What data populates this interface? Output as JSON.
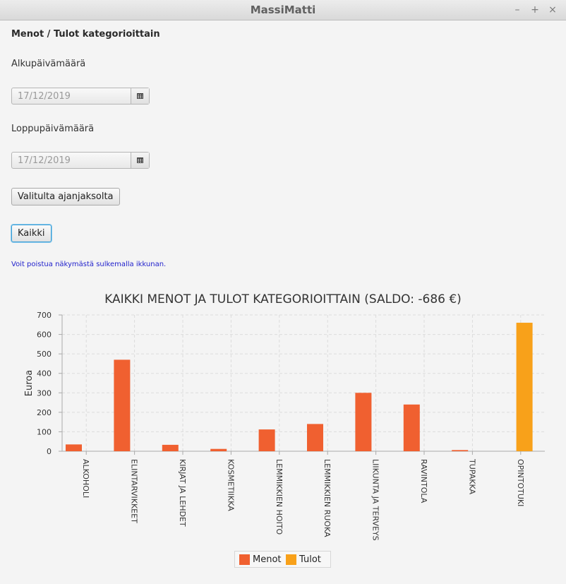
{
  "window": {
    "title": "MassiMatti",
    "minimize": "–",
    "maximize": "+",
    "close": "×"
  },
  "heading": "Menot / Tulot kategorioittain",
  "start_date": {
    "label": "Alkupäivämäärä",
    "value": "17/12/2019"
  },
  "end_date": {
    "label": "Loppupäivämäärä",
    "value": "17/12/2019"
  },
  "buttons": {
    "period": "Valitulta ajanjaksolta",
    "all": "Kaikki"
  },
  "hint": "Voit poistua näkymästä sulkemalla ikkunan.",
  "colors": {
    "menot": "#f06030",
    "tulot": "#f8a11a"
  },
  "chart_data": {
    "type": "bar",
    "title": "KAIKKI MENOT JA TULOT KATEGORIOITTAIN (SALDO: -686 €)",
    "ylabel": "Euroa",
    "xlabel": "",
    "ylim": [
      0,
      700
    ],
    "yticks": [
      0,
      100,
      200,
      300,
      400,
      500,
      600,
      700
    ],
    "grid": true,
    "legend_position": "bottom",
    "categories": [
      "ALKOHOLI",
      "ELINTARVIKKEET",
      "KIRJAT JA LEHDET",
      "KOSMETIIKKA",
      "LEMMIKKIEN HOITO",
      "LEMMIKKIEN RUOKA",
      "LIIKUNTA JA TERVEYS",
      "RAVINTOLA",
      "TUPAKKA",
      "OPINTOTUKI"
    ],
    "series": [
      {
        "name": "Menot",
        "values": [
          35,
          470,
          33,
          12,
          112,
          140,
          300,
          240,
          6,
          0
        ]
      },
      {
        "name": "Tulot",
        "values": [
          0,
          0,
          0,
          0,
          0,
          0,
          0,
          0,
          0,
          660
        ]
      }
    ]
  }
}
